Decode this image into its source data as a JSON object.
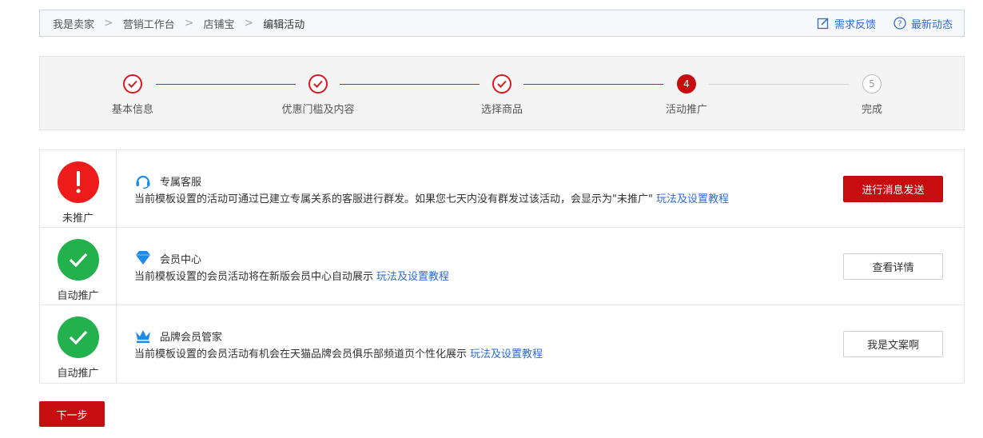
{
  "breadcrumb": {
    "items": [
      "我是卖家",
      "营销工作台",
      "店铺宝",
      "编辑活动"
    ]
  },
  "top_links": {
    "feedback": "需求反馈",
    "news": "最新动态"
  },
  "steps": [
    {
      "label": "基本信息",
      "state": "done"
    },
    {
      "label": "优惠门槛及内容",
      "state": "done"
    },
    {
      "label": "选择商品",
      "state": "done"
    },
    {
      "label": "活动推广",
      "state": "active",
      "number": "4"
    },
    {
      "label": "完成",
      "state": "todo",
      "number": "5"
    }
  ],
  "promos": [
    {
      "status": "未推广",
      "status_type": "warn",
      "title": "专属客服",
      "icon": "headset-icon",
      "desc": "当前模板设置的活动可通过已建立专属关系的客服进行群发。如果您七天内没有群发过该活动，会显示为\"未推广\"",
      "link": "玩法及设置教程",
      "button": "进行消息发送"
    },
    {
      "status": "自动推广",
      "status_type": "ok",
      "title": "会员中心",
      "icon": "diamond-icon",
      "desc": "当前模板设置的会员活动将在新版会员中心自动展示",
      "link": "玩法及设置教程",
      "button": "查看详情"
    },
    {
      "status": "自动推广",
      "status_type": "ok",
      "title": "品牌会员管家",
      "icon": "crown-icon",
      "desc": "当前模板设置的会员活动有机会在天猫品牌会员俱乐部频道页个性化展示",
      "link": "玩法及设置教程",
      "button": "我是文案啊"
    }
  ],
  "next_button": "下一步",
  "colors": {
    "brand_red": "#c80d11",
    "link_blue": "#2d6bd3",
    "success_green": "#22b14c",
    "warn_red": "#ee1b1b"
  }
}
